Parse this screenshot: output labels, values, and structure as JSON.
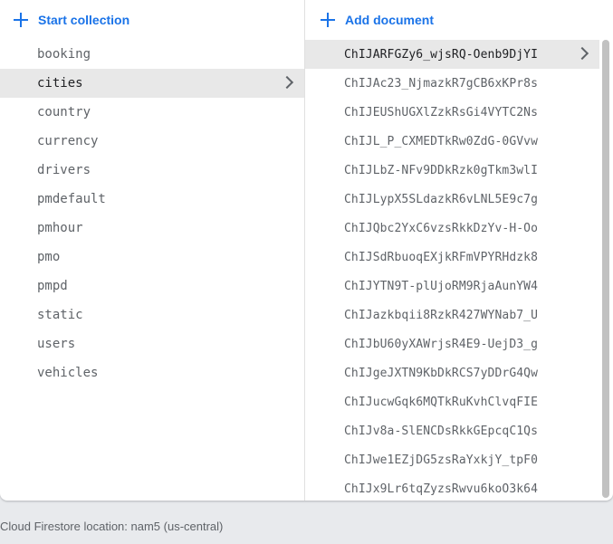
{
  "collections_panel": {
    "add_label": "Start collection",
    "items": [
      "booking",
      "cities",
      "country",
      "currency",
      "drivers",
      "pmdefault",
      "pmhour",
      "pmo",
      "pmpd",
      "static",
      "users",
      "vehicles"
    ],
    "selected": "cities"
  },
  "documents_panel": {
    "add_label": "Add document",
    "items": [
      "ChIJARFGZy6_wjsRQ-Oenb9DjYI",
      "ChIJAc23_NjmazkR7gCB6xKPr8s",
      "ChIJEUShUGXlZzkRsGi4VYTC2Ns",
      "ChIJL_P_CXMEDTkRw0ZdG-0GVvw",
      "ChIJLbZ-NFv9DDkRzk0gTkm3wlI",
      "ChIJLypX5SLdazkR6vLNL5E9c7g",
      "ChIJQbc2YxC6vzsRkkDzYv-H-Oo",
      "ChIJSdRbuoqEXjkRFmVPYRHdzk8",
      "ChIJYTN9T-plUjoRM9RjaAunYW4",
      "ChIJazkbqii8RzkR427WYNab7_U",
      "ChIJbU60yXAWrjsR4E9-UejD3_g",
      "ChIJgeJXTN9KbDkRCS7yDDrG4Qw",
      "ChIJucwGqk6MQTkRuKvhClvqFIE",
      "ChIJv8a-SlENCDsRkkGEpcqC1Qs",
      "ChIJwe1EZjDG5zsRaYxkjY_tpF0",
      "ChIJx9Lr6tqZyzsRwvu6koO3k64"
    ],
    "selected": "ChIJARFGZy6_wjsRQ-Oenb9DjYI"
  },
  "footer": {
    "location_text": "Cloud Firestore location: nam5 (us-central)"
  },
  "colors": {
    "accent": "#1a73e8",
    "selected_bg": "#e8e8e8"
  }
}
